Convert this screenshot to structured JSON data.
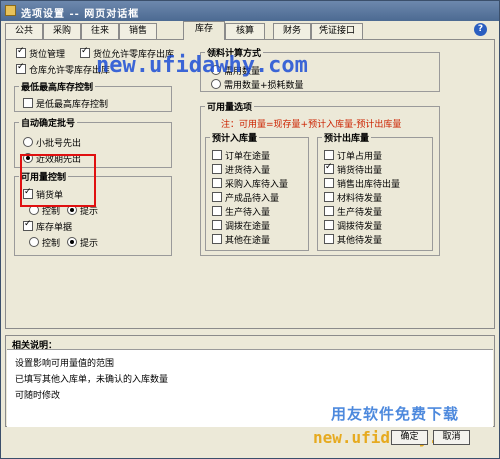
{
  "window": {
    "title": "选项设置 -- 网页对话框"
  },
  "tabs": [
    {
      "label": "公共"
    },
    {
      "label": "采购"
    },
    {
      "label": "往来"
    },
    {
      "label": "销售"
    },
    {
      "label": "库存"
    },
    {
      "label": "核算"
    },
    {
      "label": "财务"
    },
    {
      "label": "凭证接口"
    }
  ],
  "active_tab": "库存",
  "help": {
    "label": "?"
  },
  "top_checks": {
    "location_mgmt": {
      "label": "货位管理",
      "checked": true
    },
    "location_zero_out": {
      "label": "货位允许零库存出库",
      "checked": true
    },
    "warehouse_zero_out": {
      "label": "仓库允许零库存出库",
      "checked": true
    }
  },
  "min_stock": {
    "title": "最低最高库存控制",
    "option": {
      "label": "是低最高库存控制",
      "checked": false
    }
  },
  "auto_batch": {
    "title": "自动确定批号",
    "options": [
      {
        "label": "小批号先出",
        "selected": false
      },
      {
        "label": "近效期先出",
        "selected": true
      }
    ]
  },
  "avail_control": {
    "title": "可用量控制",
    "sales": {
      "label": "销货单",
      "checked": true
    },
    "sales_mode": [
      {
        "label": "控制",
        "selected": false
      },
      {
        "label": "提示",
        "selected": true
      }
    ],
    "out": {
      "label": "库存单据",
      "checked": true
    },
    "out_mode": [
      {
        "label": "控制",
        "selected": false
      },
      {
        "label": "提示",
        "selected": true
      }
    ]
  },
  "receive_calc": {
    "title": "领料计算方式",
    "options": [
      {
        "label": "需用数量",
        "selected": false
      },
      {
        "label": "需用数量+损耗数量",
        "selected": false
      }
    ]
  },
  "avail_options": {
    "title": "可用量选项",
    "note": "注：可用量=现存量+预计入库量-预计出库量",
    "in_title": "预计入库量",
    "in_items": [
      {
        "label": "订单在途量",
        "checked": false
      },
      {
        "label": "进货待入量",
        "checked": false
      },
      {
        "label": "采购入库待入量",
        "checked": false
      },
      {
        "label": "产成品待入量",
        "checked": false
      },
      {
        "label": "生产待入量",
        "checked": false
      },
      {
        "label": "调拨在途量",
        "checked": false
      },
      {
        "label": "其他在途量",
        "checked": false
      }
    ],
    "out_title": "预计出库量",
    "out_items": [
      {
        "label": "订单占用量",
        "checked": false
      },
      {
        "label": "销货待出量",
        "checked": true
      },
      {
        "label": "销售出库待出量",
        "checked": false
      },
      {
        "label": "材料待发量",
        "checked": false
      },
      {
        "label": "生产待发量",
        "checked": false
      },
      {
        "label": "调拨待发量",
        "checked": false
      },
      {
        "label": "其他待发量",
        "checked": false
      }
    ]
  },
  "description": {
    "title": "相关说明：",
    "lines": [
      "设置影响可用量值的范围",
      "已填写其他入库单，未确认的入库数量",
      "可随时修改"
    ]
  },
  "buttons": {
    "ok": "确定",
    "cancel": "取消"
  },
  "watermarks": {
    "url_top": "new.ufidawhy.com",
    "brand": "用友软件免费下载",
    "url_bottom": "new.ufidawhy.com"
  },
  "colors": {
    "title_bar": "#4c6a92",
    "note_red": "#cc2200",
    "highlight_box": "#e01010"
  }
}
